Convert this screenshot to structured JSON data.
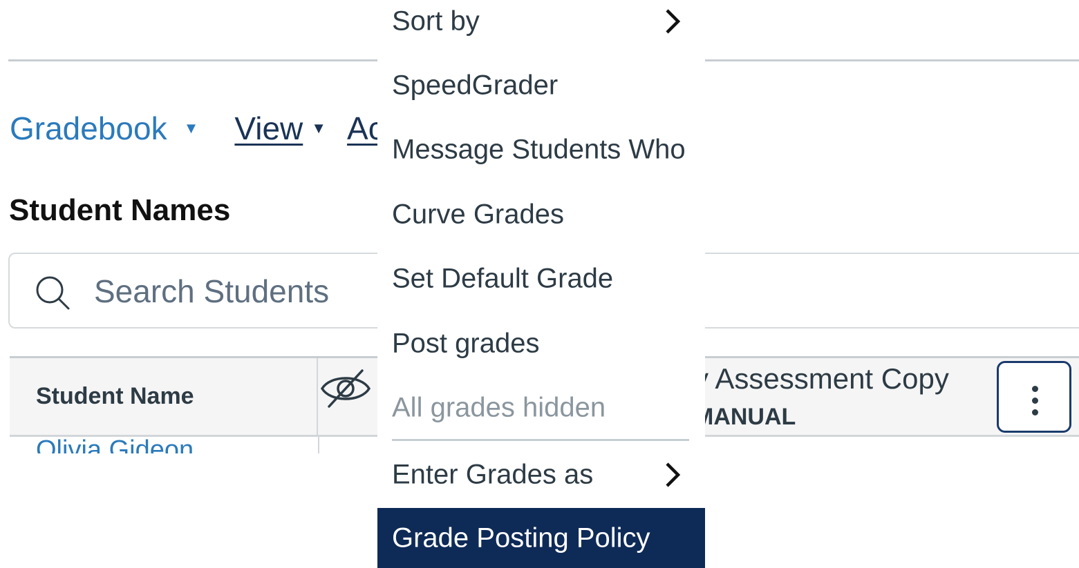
{
  "nav": {
    "gradebook": "Gradebook",
    "view": "View",
    "actions_partial": "Ac"
  },
  "section": {
    "title": "Student Names"
  },
  "search": {
    "placeholder": "Search Students",
    "value": ""
  },
  "grid": {
    "header_student": "Student Name",
    "header_assignment_title": "y Assessment Copy",
    "header_assignment_sub": "MANUAL",
    "student_partial": "Olivia Gideon"
  },
  "menu": {
    "items": [
      {
        "label": "Sort by",
        "submenu": true
      },
      {
        "label": "SpeedGrader"
      },
      {
        "label": "Message Students Who"
      },
      {
        "label": "Curve Grades"
      },
      {
        "label": "Set Default Grade"
      },
      {
        "label": "Post grades"
      },
      {
        "label": "All grades hidden",
        "disabled": true
      },
      {
        "label": "Enter Grades as",
        "submenu": true
      },
      {
        "label": "Grade Posting Policy",
        "active": true
      }
    ]
  },
  "colors": {
    "link": "#2b7abc",
    "navy": "#1a3356",
    "menu_active_bg": "#0e2a57",
    "disabled_text": "#8b969e"
  },
  "icons": [
    "search-icon",
    "eye-off-icon",
    "chevron-right-icon",
    "kebab-menu-icon",
    "caret-down-icon"
  ]
}
